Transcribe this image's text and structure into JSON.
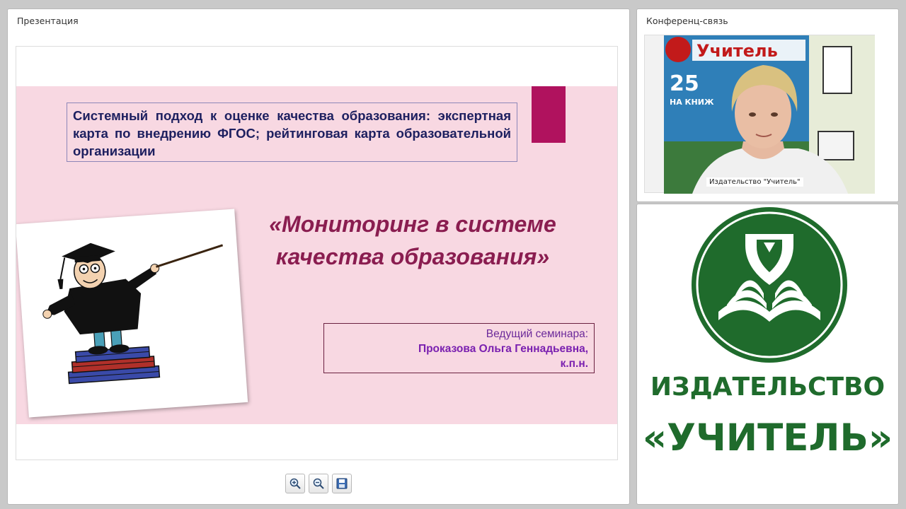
{
  "presentation_panel": {
    "title": "Презентация",
    "slide": {
      "subject": "Системный подход к оценке качества образования: экспертная карта по внедрению ФГОС; рейтинговая карта образовательной организации",
      "title_line1": "«Мониторинг в системе",
      "title_line2": "качества образования»",
      "presenter_label": "Ведущий семинара:",
      "presenter_name": "Проказова Ольга Геннадьевна,",
      "presenter_degree": "к.п.н.",
      "colors": {
        "band": "#f8d8e2",
        "accent": "#b0125e",
        "title": "#8a1d50",
        "subject_text": "#1e2060",
        "presenter_text": "#7a20b0"
      }
    },
    "toolbar": {
      "zoom_in_icon": "zoom-in-icon",
      "zoom_out_icon": "zoom-out-icon",
      "save_icon": "save-icon"
    }
  },
  "conference_panel": {
    "title": "Конференц-связь",
    "video_label": "Издательство \"Учитель\""
  },
  "logo_panel": {
    "line1": "ИЗДАТЕЛЬСТВО",
    "line2": "«УЧИТЕЛЬ»",
    "color": "#1f6b2c"
  }
}
